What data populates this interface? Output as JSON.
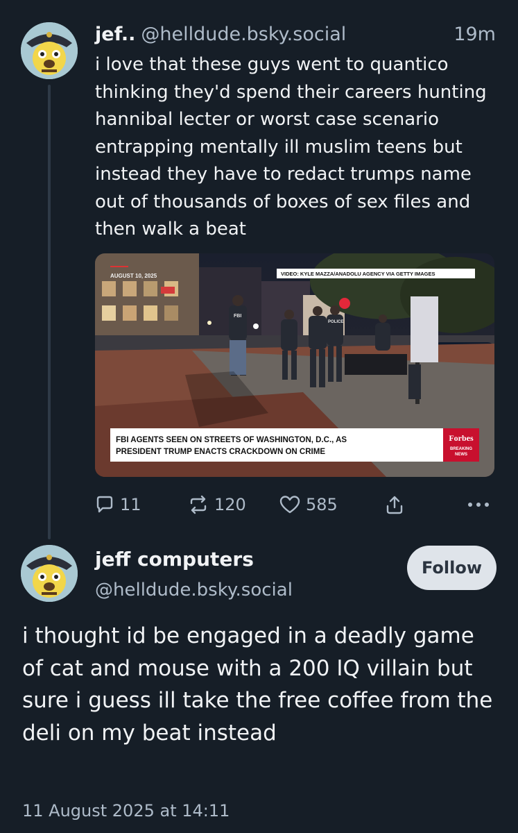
{
  "post1": {
    "display_name": "jef..",
    "handle": "@helldude.bsky.social",
    "time": "19m",
    "text": "i love that these guys went to quantico thinking they'd spend their careers hunting hannibal lecter or worst case scenario entrapping mentally ill muslim teens but instead they have to redact trumps name out of thousands of boxes of sex files and then walk a beat",
    "media": {
      "date_label": "AUGUST 10, 2025",
      "credit": "VIDEO: KYLE MAZZA/ANADOLU AGENCY VIA GETTY IMAGES",
      "headline_line1": "FBI AGENTS SEEN ON STREETS OF WASHINGTON, D.C., AS",
      "headline_line2": "PRESIDENT TRUMP ENACTS CRACKDOWN ON CRIME",
      "brand": "Forbes",
      "brand_tag_line1": "BREAKING",
      "brand_tag_line2": "NEWS",
      "vest_label": "FBI",
      "vest_label_2": "POLICE"
    },
    "actions": {
      "replies": "11",
      "reposts": "120",
      "likes": "585"
    }
  },
  "post2": {
    "display_name": "jeff computers",
    "handle": "@helldude.bsky.social",
    "follow_label": "Follow",
    "text": "i thought id be engaged in a deadly game of cat and mouse with a 200 IQ villain but sure i guess ill take the free coffee from the deli on my beat instead",
    "timestamp": "11 August 2025 at 14:11"
  },
  "colors": {
    "background": "#161e27",
    "text_primary": "#f1f3f5",
    "text_secondary": "#aebbc9",
    "follow_button_bg": "#dfe4ea",
    "thread_line": "#2e3a47"
  },
  "icons": [
    "reply-icon",
    "repost-icon",
    "like-icon",
    "share-icon",
    "more-icon"
  ]
}
